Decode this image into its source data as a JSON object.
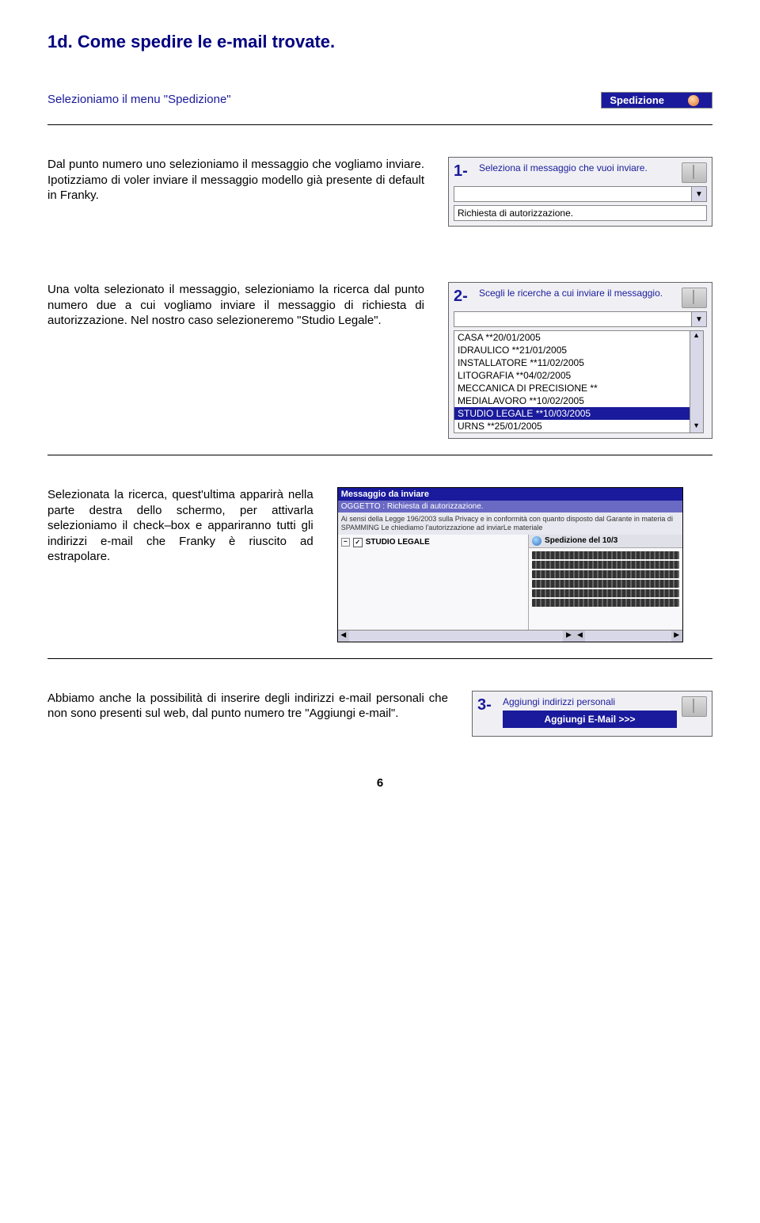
{
  "title": "1d. Come spedire le e-mail trovate.",
  "section1": {
    "text": "Selezioniamo il menu \"Spedizione\"",
    "button_label": "Spedizione"
  },
  "section2": {
    "text": "Dal punto numero uno selezioniamo il messaggio che vogliamo inviare. Ipotizziamo di voler inviare il messaggio modello già presente di default in Franky.",
    "step_num": "1-",
    "step_text": "Seleziona il messaggio che vuoi inviare.",
    "dropdown_value": "",
    "field_value": "Richiesta di autorizzazione."
  },
  "section3": {
    "text": "Una volta selezionato il messaggio, selezioniamo la ricerca dal punto numero due a cui vogliamo inviare il messaggio di richiesta di autorizzazione. Nel nostro caso selezioneremo \"Studio Legale\".",
    "step_num": "2-",
    "step_text": "Scegli le ricerche a cui inviare il messaggio.",
    "list_items": [
      "CASA **20/01/2005",
      "IDRAULICO **21/01/2005",
      "INSTALLATORE **11/02/2005",
      "LITOGRAFIA **04/02/2005",
      "MECCANICA DI PRECISIONE **",
      "MEDIALAVORO **10/02/2005",
      "STUDIO LEGALE **10/03/2005",
      "URNS **25/01/2005"
    ],
    "selected_index": 6
  },
  "section4": {
    "text": "Selezionata la ricerca, quest'ultima apparirà nella parte destra dello schermo, per attivarla selezioniamo il check–box    e appariranno tutti gli indirizzi e-mail che Franky è riuscito ad  estrapolare.",
    "panel_title": "Messaggio da inviare",
    "panel_subject": "OGGETTO : Richiesta di autorizzazione.",
    "panel_body": "Ai sensi della Legge 196/2003 sulla Privacy e in conformità con quanto disposto dal Garante in materia di SPAMMING Le chiediamo l'autorizzazione ad inviarLe materiale",
    "tree_label": "STUDIO LEGALE",
    "right_header": "Spedizione del 10/3"
  },
  "section5": {
    "text": "Abbiamo anche la possibilità di inserire degli indirizzi e-mail personali che non sono presenti sul web, dal punto numero tre  \"Aggiungi e-mail\".",
    "step_num": "3-",
    "step_text": "Aggiungi indirizzi personali",
    "button_label": "Aggiungi E-Mail >>>"
  },
  "page_number": "6"
}
